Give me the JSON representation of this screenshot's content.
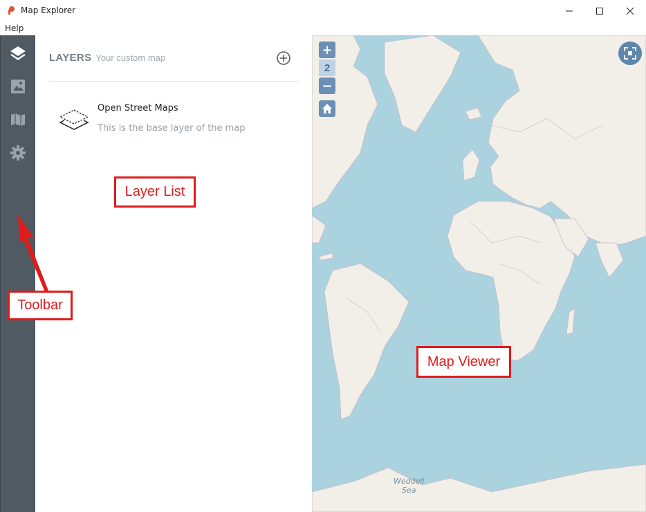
{
  "window": {
    "title": "Map Explorer",
    "icon": "app-logo-icon",
    "controls": [
      "minimize-icon",
      "maximize-icon",
      "close-icon"
    ]
  },
  "menu": {
    "items": [
      "Help"
    ]
  },
  "toolbar": {
    "tools": [
      "layers-icon",
      "image-icon",
      "map-icon",
      "gear-icon"
    ]
  },
  "layers_panel": {
    "title": "LAYERS",
    "subtitle": "Your custom map",
    "add_icon": "add-circle-icon",
    "layers": [
      {
        "name": "Open Street Maps",
        "description": "This is the base layer of the map",
        "icon": "layer-stack-icon"
      }
    ]
  },
  "map": {
    "zoom_in_label": "+",
    "zoom_level": "2",
    "zoom_out_label": "−",
    "home_icon": "home-icon",
    "fullscreen_icon": "fullscreen-icon",
    "sea_label_line1": "Weddell",
    "sea_label_line2": "Sea",
    "colors": {
      "ocean": "#aad3df",
      "land": "#f2efe9",
      "border": "#b9a8c0",
      "controls": "#6b8fb5"
    }
  },
  "annotations": {
    "layer_list": "Layer List",
    "toolbar": "Toolbar",
    "map_viewer": "Map Viewer",
    "color": "#e01b1b"
  }
}
